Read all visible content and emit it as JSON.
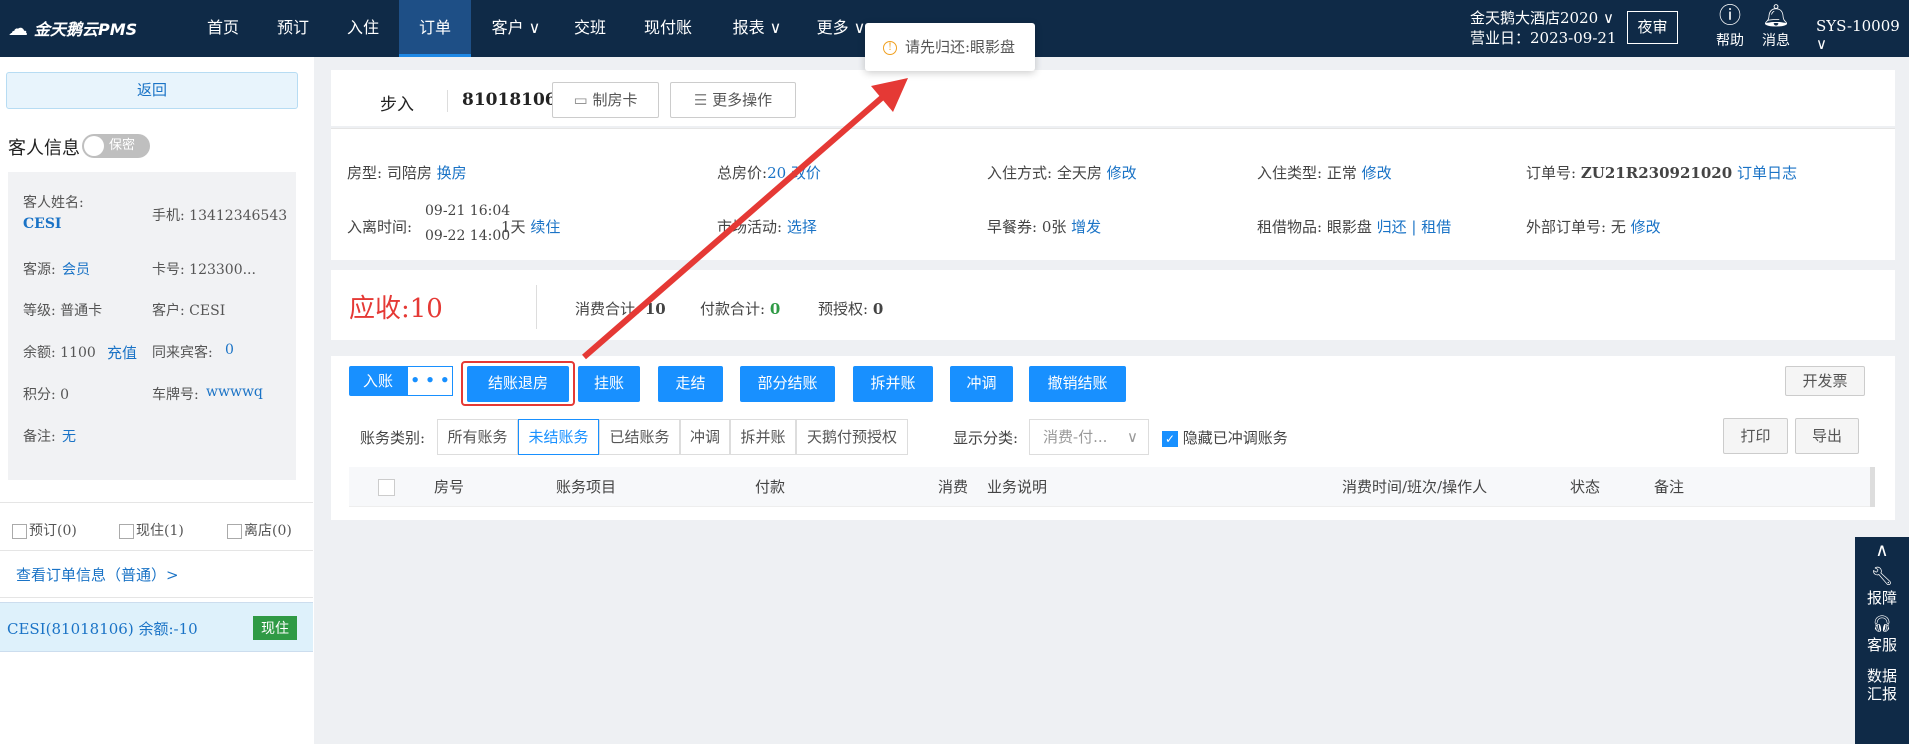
{
  "topbar": {
    "logo": "金天鹅云PMS",
    "nav": [
      "首页",
      "预订",
      "入住",
      "订单",
      "客户 ∨",
      "交班",
      "现付账",
      "报表 ∨",
      "更多 ∨"
    ],
    "hotel": "金天鹅大酒店2020 ∨",
    "biz_date": "营业日：2023-09-21",
    "night_audit": "夜审",
    "help": "帮助",
    "message": "消息",
    "user": "SYS-10009 ∨"
  },
  "toast": {
    "text": "请先归还:眼影盘"
  },
  "left": {
    "back": "返回",
    "guest_title": "客人信息",
    "privacy": "保密",
    "guest_name_label": "客人姓名:",
    "guest_name": "CESI",
    "phone": "手机: 13412346543",
    "source_label": "客源:",
    "source": "会员",
    "card": "卡号: 123300...",
    "level": "等级: 普通卡",
    "customer": "客户: CESI",
    "balance": "余额: 1100",
    "recharge": "充值",
    "companion_label": "同来宾客:",
    "companion": "0",
    "points": "积分: 0",
    "plate_label": "车牌号:",
    "plate": "wwwwq",
    "remark_label": "备注:",
    "remark": "无",
    "filter_reserved": "预订(0)",
    "filter_checked": "现住(1)",
    "filter_left": "离店(0)",
    "order_link": "查看订单信息（普通）>",
    "order_row": "CESI(81018106)   余额:-10",
    "order_status": "现住"
  },
  "order": {
    "walk_in": "步入",
    "order_no": "81018106",
    "make_card": "制房卡",
    "more_ops": "更多操作"
  },
  "info": {
    "room_type_label": "房型:",
    "room_type": "司陪房",
    "change_room": "换房",
    "total_label": "总房价:",
    "total": "20 改价",
    "checkin_way_label": "入住方式:",
    "checkin_way": "全天房",
    "modify": "修改",
    "checkin_type_label": "入住类型:",
    "checkin_type": "正常",
    "order_id_label": "订单号:",
    "order_id": "ZU21R230921020",
    "order_log": "订单日志",
    "stay_label": "入离时间:",
    "stay_in": "09-21 16:04",
    "stay_out": "09-22 14:00",
    "nights": "1天",
    "extend": "续住",
    "market_label": "市场活动:",
    "market": "选择",
    "breakfast_label": "早餐券:",
    "breakfast": "0张",
    "add": "增发",
    "rental_label": "租借物品:",
    "rental": "眼影盘",
    "return_item": "归还",
    "borrow": "租借",
    "ext_label": "外部订单号:",
    "ext": "无"
  },
  "summary": {
    "receivable_label": "应收:",
    "receivable": "10",
    "consume_label": "消费合计:",
    "consume": "10",
    "paid_label": "付款合计:",
    "paid": "0",
    "preauth_label": "预授权:",
    "preauth": "0"
  },
  "actions": {
    "post": "入账",
    "checkout": "结账退房",
    "hang": "挂账",
    "walk": "走结",
    "partial": "部分结账",
    "split": "拆并账",
    "reverse": "冲调",
    "undo": "撤销结账",
    "invoice": "开发票"
  },
  "filters": {
    "label": "账务类别:",
    "tabs": [
      "所有账务",
      "未结账务",
      "已结账务",
      "冲调",
      "拆并账",
      "天鹅付预授权"
    ],
    "display_label": "显示分类:",
    "display": "消费-付...",
    "hide": "隐藏已冲调账务",
    "print": "打印",
    "export": "导出"
  },
  "table": {
    "headers": [
      "房号",
      "账务项目",
      "付款",
      "消费",
      "业务说明",
      "消费时间/班次/操作人",
      "状态",
      "备注"
    ]
  },
  "side": {
    "report": "报障",
    "service": "客服",
    "data1": "数据",
    "data2": "汇报"
  }
}
